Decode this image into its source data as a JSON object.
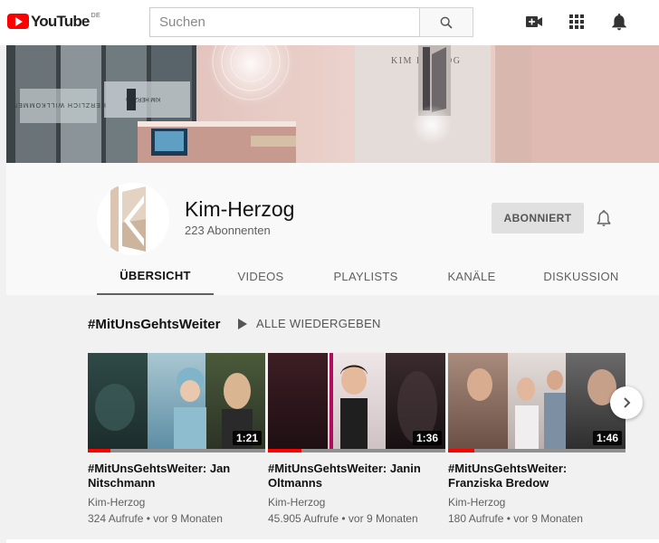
{
  "masthead": {
    "logo_text": "YouTube",
    "country_code": "DE",
    "search_placeholder": "Suchen",
    "icons": [
      "search-icon",
      "create-video-icon",
      "apps-grid-icon",
      "notifications-bell-icon"
    ]
  },
  "channel": {
    "name": "Kim-Herzog",
    "subscribers": "223 Abonnenten",
    "subscribe_label": "ABONNIERT",
    "banner_text_left": "HERZLICH WILLKOMMEN",
    "banner_logo_small": "KIM HERZOG",
    "banner_logo_large": "KIM HERZOG"
  },
  "tabs": [
    {
      "label": "ÜBERSICHT",
      "active": true
    },
    {
      "label": "VIDEOS",
      "active": false
    },
    {
      "label": "PLAYLISTS",
      "active": false
    },
    {
      "label": "KANÄLE",
      "active": false
    },
    {
      "label": "DISKUSSION",
      "active": false
    }
  ],
  "shelf": {
    "title": "#MitUnsGehtsWeiter",
    "play_all_label": "ALLE WIEDERGEBEN",
    "videos": [
      {
        "title": "#MitUnsGehtsWeiter: Jan Nitschmann",
        "channel": "Kim-Herzog",
        "meta": "324 Aufrufe • vor 9 Monaten",
        "duration": "1:21",
        "watched": 0.13
      },
      {
        "title": "#MitUnsGehtsWeiter: Janin Oltmanns",
        "channel": "Kim-Herzog",
        "meta": "45.905 Aufrufe • vor 9 Monaten",
        "duration": "1:36",
        "watched": 0.19
      },
      {
        "title": "#MitUnsGehtsWeiter: Franziska Bredow",
        "channel": "Kim-Herzog",
        "meta": "180 Aufrufe • vor 9 Monaten",
        "duration": "1:46",
        "watched": 0.15
      }
    ]
  },
  "colors": {
    "brand_red": "#ff0000",
    "banner_pink": "#e7c9c3",
    "avatar_beige": "#d9c5b2"
  }
}
